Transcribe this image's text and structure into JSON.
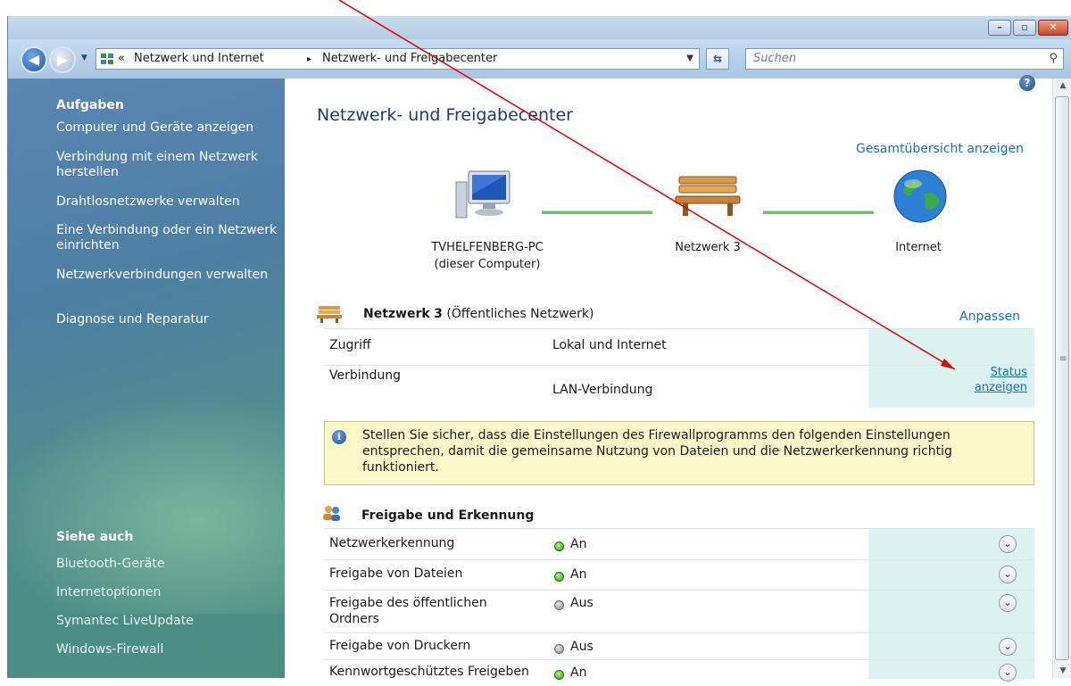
{
  "address": {
    "overflow": "«",
    "crumbs": [
      "Netzwerk und Internet",
      "Netzwerk- und Freigabecenter"
    ],
    "separator": "▸"
  },
  "search": {
    "placeholder": "Suchen"
  },
  "sidebar": {
    "tasks_title": "Aufgaben",
    "tasks": [
      "Computer und Geräte anzeigen",
      "Verbindung mit einem Netzwerk herstellen",
      "Drahtlosnetzwerke verwalten",
      "Eine Verbindung oder ein Netzwerk einrichten",
      "Netzwerkverbindungen verwalten",
      "Diagnose und Reparatur"
    ],
    "see_also_title": "Siehe auch",
    "see_also": [
      "Bluetooth-Geräte",
      "Internetoptionen",
      "Symantec LiveUpdate",
      "Windows-Firewall"
    ]
  },
  "main": {
    "title": "Netzwerk- und Freigabecenter",
    "overview_link": "Gesamtübersicht anzeigen",
    "map": {
      "computer_name": "TVHELFENBERG-PC",
      "computer_sub": "(dieser Computer)",
      "network": "Netzwerk 3",
      "internet": "Internet"
    },
    "network": {
      "name": "Netzwerk",
      "number": "3",
      "type": "(Öffentliches Netzwerk)",
      "customize": "Anpassen",
      "rows": [
        {
          "label": "Zugriff",
          "value": "Lokal und Internet"
        },
        {
          "label": "Verbindung",
          "value": "LAN-Verbindung"
        }
      ],
      "status_link": [
        "Status",
        "anzeigen"
      ]
    },
    "info": "Stellen Sie sicher, dass die Einstellungen des Firewallprogramms den folgenden Einstellungen entsprechen, damit die gemeinsame Nutzung von Dateien und die Netzwerkerkennung richtig funktioniert.",
    "sharing": {
      "title": "Freigabe und Erkennung",
      "items": [
        {
          "label": "Netzwerkerkennung",
          "state": "An",
          "on": true
        },
        {
          "label": "Freigabe von Dateien",
          "state": "An",
          "on": true
        },
        {
          "label": "Freigabe des öffentlichen Ordners",
          "state": "Aus",
          "on": false
        },
        {
          "label": "Freigabe von Druckern",
          "state": "Aus",
          "on": false
        },
        {
          "label": "Kennwortgeschütztes Freigeben",
          "state": "An",
          "on": true
        }
      ]
    }
  },
  "colors": {
    "link": "#1a6fb5",
    "connector": "#6cc16c",
    "info_bg": "#fbf8c9",
    "tint": "#dcf1f1",
    "annotation": "#e00000"
  },
  "icons": [
    "back-icon",
    "forward-icon",
    "network-folder-icon",
    "refresh-icon",
    "search-icon",
    "help-icon",
    "computer-icon",
    "bench-icon",
    "globe-icon",
    "info-icon",
    "sharing-icon",
    "chevron-down-icon"
  ]
}
